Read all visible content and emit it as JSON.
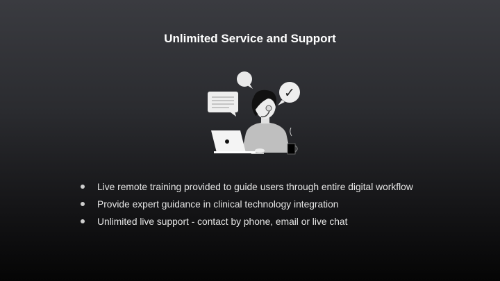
{
  "slide": {
    "title": "Unlimited Service and Support",
    "bullets": [
      "Live remote training provided to guide users through entire digital workflow",
      "Provide expert guidance in clinical technology integration",
      "Unlimited live support - contact by phone, email or live chat"
    ]
  },
  "illustration": {
    "icon": "support-agent-icon",
    "check_glyph": "✓"
  }
}
